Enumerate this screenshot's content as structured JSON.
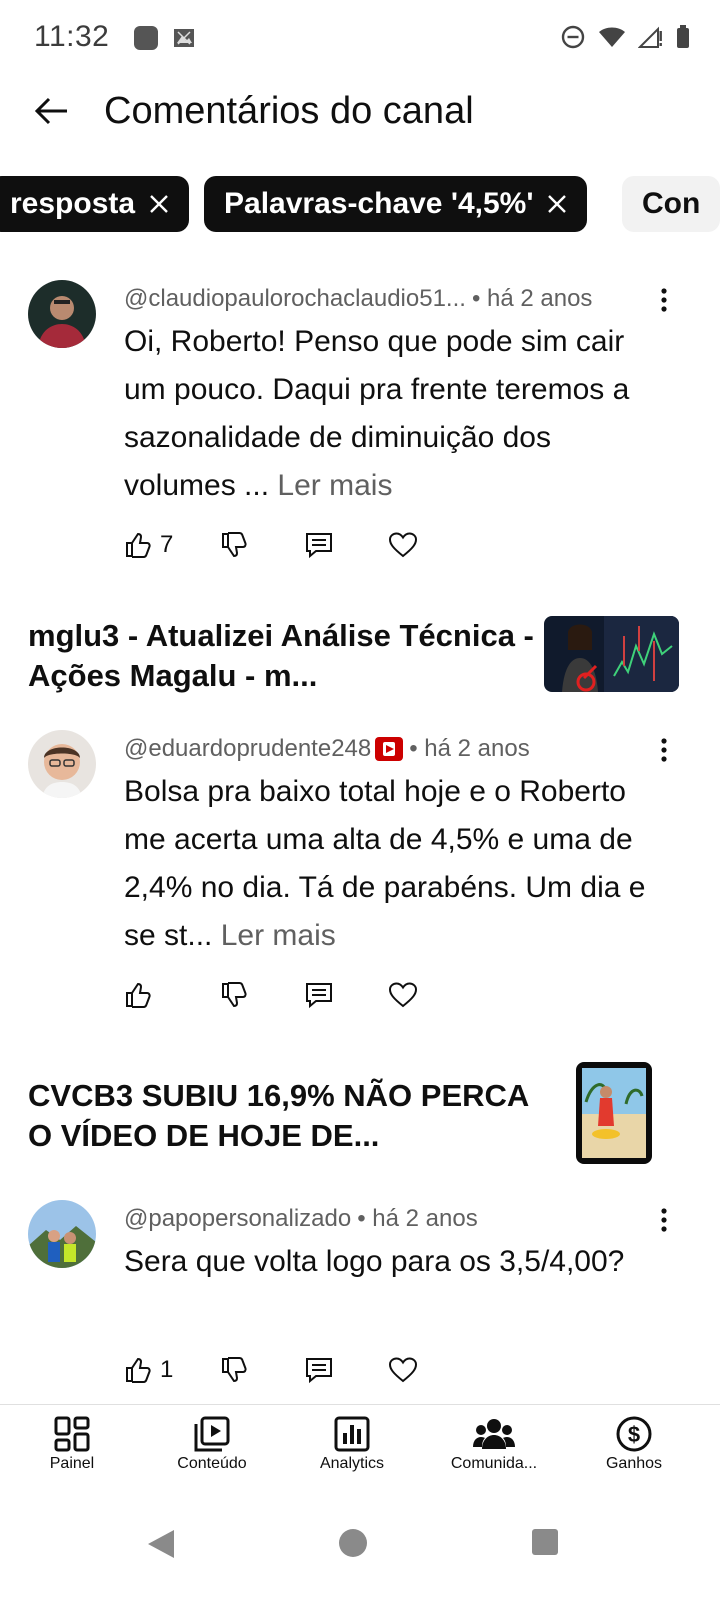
{
  "status_bar": {
    "time": "11:32"
  },
  "app_bar": {
    "title": "Comentários do canal"
  },
  "filter_chips": [
    {
      "label": "resposta",
      "state": "selected"
    },
    {
      "label": "Palavras-chave '4,5%'",
      "state": "selected"
    },
    {
      "label": "Con",
      "state": "unselected"
    }
  ],
  "comments": [
    {
      "author": "@claudiopaulorochaclaudio51...",
      "time": "• há 2 anos",
      "creator_badge": false,
      "text": "Oi, Roberto! Penso que pode sim cair um pouco. Daqui pra frente teremos a sazonalidade de diminuição dos volumes ...",
      "read_more": "Ler mais",
      "likes": "7"
    },
    {
      "author": "@eduardoprudente248",
      "time": "• há 2 anos",
      "creator_badge": true,
      "text": "Bolsa pra baixo total hoje e o Roberto me acerta uma alta de 4,5% e uma de 2,4% no dia. Tá de parabéns. Um dia e se st...",
      "read_more": "Ler mais",
      "likes": ""
    },
    {
      "author": "@papopersonalizado",
      "time": "• há 2 anos",
      "creator_badge": false,
      "text": "Sera que volta logo para os 3,5/4,00?",
      "read_more": "",
      "likes": "1"
    }
  ],
  "videos": [
    {
      "title": "mglu3 - Atualizei Análise Técnica - Ações Magalu - m..."
    },
    {
      "title": "CVCB3 SUBIU 16,9% NÃO PERCA O VÍDEO DE HOJE DE..."
    }
  ],
  "bottom_nav": [
    {
      "label": "Painel",
      "icon": "dashboard-icon"
    },
    {
      "label": "Conteúdo",
      "icon": "content-icon"
    },
    {
      "label": "Analytics",
      "icon": "analytics-icon"
    },
    {
      "label": "Comunida...",
      "icon": "community-icon"
    },
    {
      "label": "Ganhos",
      "icon": "earnings-icon"
    }
  ],
  "colors": {
    "text_primary": "#0f0f0f",
    "text_secondary": "#606060",
    "chip_selected_bg": "#0f0f0f",
    "chip_unselected_bg": "#f2f2f2",
    "badge_red": "#cc0000"
  }
}
